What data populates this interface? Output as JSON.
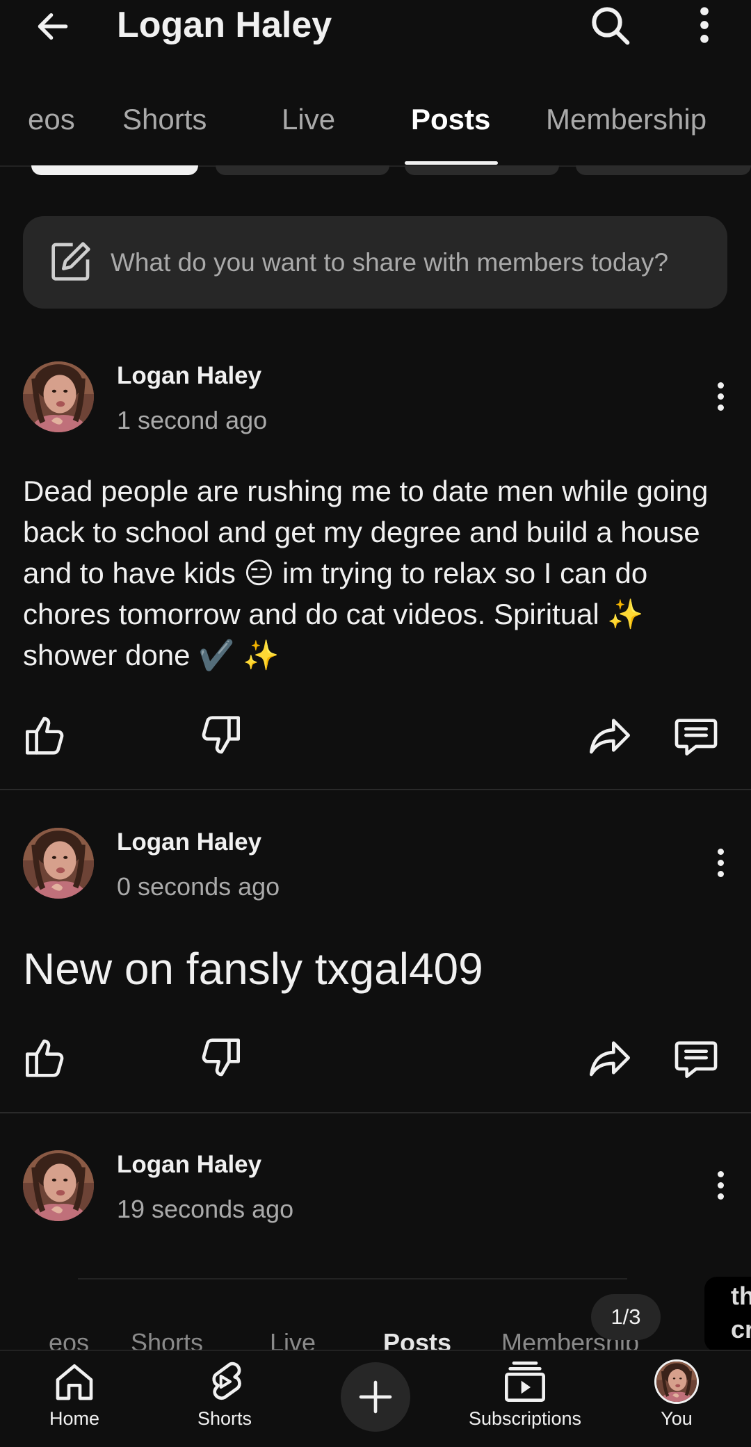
{
  "header": {
    "title": "Logan Haley",
    "icons": [
      "back-arrow-icon",
      "search-icon",
      "more-vert-icon"
    ]
  },
  "tabs": [
    {
      "label": "eos",
      "active": false
    },
    {
      "label": "Shorts",
      "active": false
    },
    {
      "label": "Live",
      "active": false
    },
    {
      "label": "Posts",
      "active": true
    },
    {
      "label": "Membership",
      "active": false
    }
  ],
  "composer": {
    "placeholder": "What do you want to share with members today?",
    "icon": "edit-square-icon"
  },
  "posts": [
    {
      "author": "Logan Haley",
      "time": "1 second ago",
      "text": "Dead people are rushing me to date men while going back to school and get my degree and build a house and to have kids 😑 im trying to relax so I can do chores tomorrow and do cat videos. Spiritual ✨ shower done ✔️ ✨"
    },
    {
      "author": "Logan Haley",
      "time": "0 seconds ago",
      "text": "New on fansly txgal409"
    },
    {
      "author": "Logan Haley",
      "time": "19 seconds ago"
    }
  ],
  "post_actions": [
    "like-icon",
    "dislike-icon",
    "share-icon",
    "comment-icon"
  ],
  "overlay": {
    "ghost_tabs": [
      "eos",
      "Shorts",
      "Live",
      "Posts",
      "Membership"
    ],
    "page_indicator": "1/3",
    "side_card_text": "th cr"
  },
  "bottom_nav": [
    {
      "label": "Home",
      "icon": "home-icon"
    },
    {
      "label": "Shorts",
      "icon": "shorts-icon"
    },
    {
      "label": "",
      "icon": "create-plus-icon"
    },
    {
      "label": "Subscriptions",
      "icon": "subscriptions-icon"
    },
    {
      "label": "You",
      "icon": "avatar"
    }
  ],
  "colors": {
    "background": "#0f0f0f",
    "surface": "#272727",
    "text_primary": "#f1f1f1",
    "text_secondary": "#aaaaaa"
  }
}
